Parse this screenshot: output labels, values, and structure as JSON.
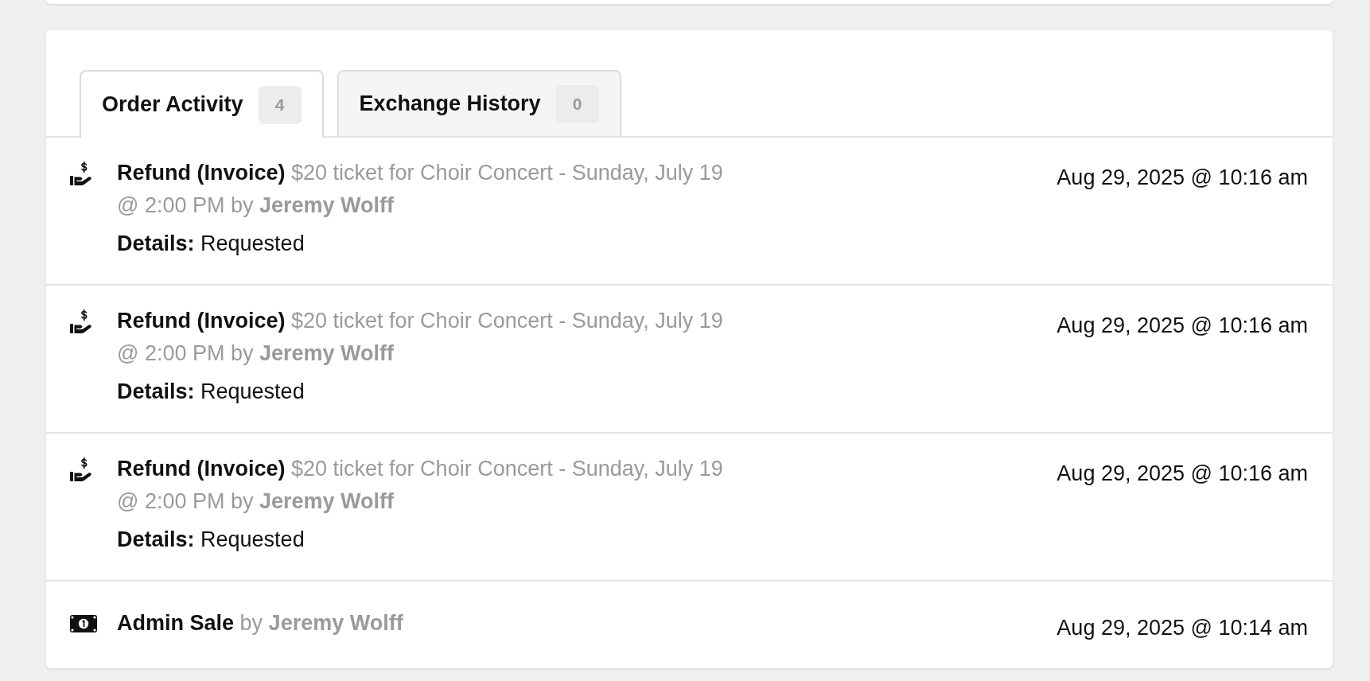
{
  "tabs": [
    {
      "label": "Order Activity",
      "count": "4",
      "selected": true
    },
    {
      "label": "Exchange History",
      "count": "0",
      "selected": false
    }
  ],
  "activities": [
    {
      "kind": "refund",
      "title": "Refund (Invoice)",
      "text": "$20 ticket for Choir Concert - Sunday, July 19 @ 2:00 PM by",
      "user": "Jeremy Wolff",
      "details": "**Details:** Requested",
      "timestamp": "Aug 29, 2025 @ 10:16 am"
    },
    {
      "kind": "refund",
      "title": "Refund (Invoice)",
      "text": "$20 ticket for Choir Concert - Sunday, July 19 @ 2:00 PM by",
      "user": "Jeremy Wolff",
      "details": "**Details:** Requested",
      "timestamp": "Aug 29, 2025 @ 10:16 am"
    },
    {
      "kind": "refund",
      "title": "Refund (Invoice)",
      "text": "$20 ticket for Choir Concert - Sunday, July 19 @ 2:00 PM by",
      "user": "Jeremy Wolff",
      "details": "**Details:** Requested",
      "timestamp": "Aug 29, 2025 @ 10:16 am"
    },
    {
      "kind": "sale",
      "title": "Admin Sale",
      "text": "by",
      "user": "Jeremy Wolff",
      "timestamp": "Aug 29, 2025 @ 10:14 am"
    }
  ]
}
